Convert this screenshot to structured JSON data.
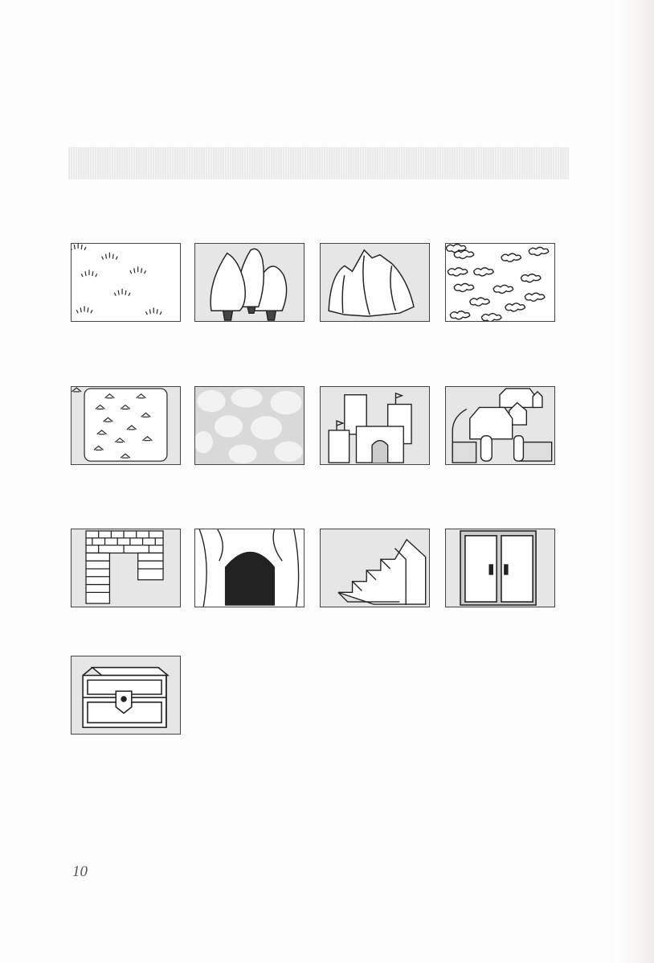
{
  "page": {
    "number": "10"
  },
  "tiles": [
    {
      "icon": "grass-plains-icon"
    },
    {
      "icon": "forest-icon"
    },
    {
      "icon": "mountains-icon"
    },
    {
      "icon": "hills-icon"
    },
    {
      "icon": "desert-icon"
    },
    {
      "icon": "swamp-icon"
    },
    {
      "icon": "castle-icon"
    },
    {
      "icon": "town-icon"
    },
    {
      "icon": "brick-wall-icon"
    },
    {
      "icon": "cave-icon"
    },
    {
      "icon": "stairs-icon"
    },
    {
      "icon": "door-icon"
    },
    {
      "icon": "treasure-chest-icon"
    }
  ]
}
